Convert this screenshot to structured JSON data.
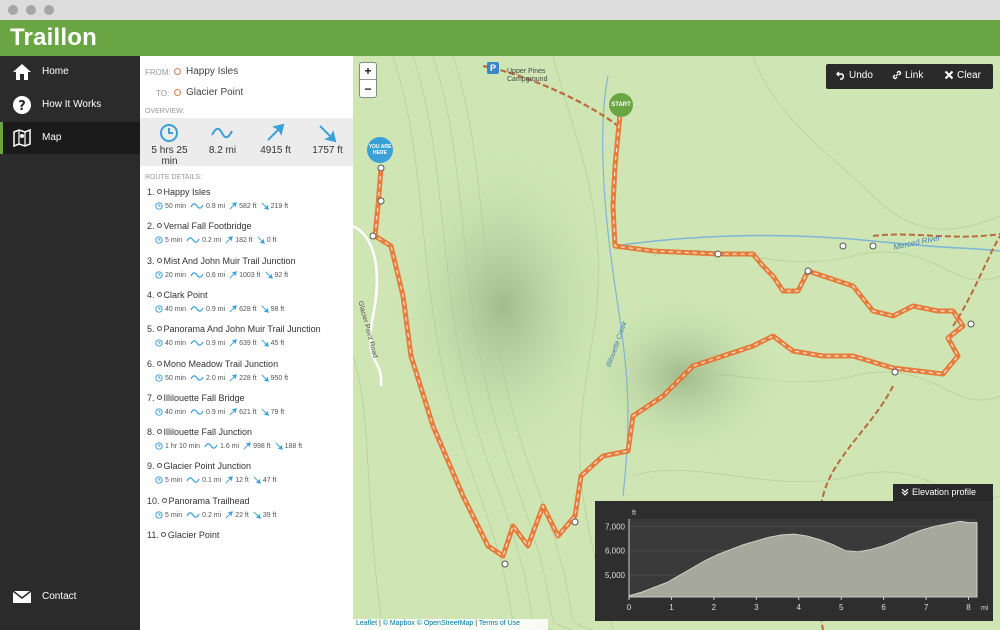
{
  "app": {
    "title": "Traillon"
  },
  "nav": {
    "home": "Home",
    "how": "How It Works",
    "map": "Map",
    "contact": "Contact"
  },
  "route": {
    "from_label": "FROM:",
    "from": "Happy Isles",
    "to_label": "TO:",
    "to": "Glacier Point"
  },
  "overview": {
    "label": "OVERVIEW:",
    "time": "5 hrs 25 min",
    "distance": "8.2 mi",
    "ascent": "4915 ft",
    "descent": "1757 ft"
  },
  "details": {
    "label": "ROUTE DETAILS:",
    "stops": [
      {
        "n": "1.",
        "name": "Happy Isles",
        "time": "50 min",
        "dist": "0.8 mi",
        "up": "582 ft",
        "down": "219 ft"
      },
      {
        "n": "2.",
        "name": "Vernal Fall Footbridge",
        "time": "5 min",
        "dist": "0.2 mi",
        "up": "182 ft",
        "down": "0 ft"
      },
      {
        "n": "3.",
        "name": "Mist And John Muir Trail Junction",
        "time": "20 min",
        "dist": "0.6 mi",
        "up": "1003 ft",
        "down": "92 ft"
      },
      {
        "n": "4.",
        "name": "Clark Point",
        "time": "40 min",
        "dist": "0.9 mi",
        "up": "628 ft",
        "down": "98 ft"
      },
      {
        "n": "5.",
        "name": "Panorama And John Muir Trail Junction",
        "time": "40 min",
        "dist": "0.9 mi",
        "up": "639 ft",
        "down": "45 ft"
      },
      {
        "n": "6.",
        "name": "Mono Meadow Trail Junction",
        "time": "50 min",
        "dist": "2.0 mi",
        "up": "228 ft",
        "down": "950 ft"
      },
      {
        "n": "7.",
        "name": "Illilouette Fall Bridge",
        "time": "40 min",
        "dist": "0.9 mi",
        "up": "621 ft",
        "down": "79 ft"
      },
      {
        "n": "8.",
        "name": "Illilouette Fall Junction",
        "time": "1 hr 10 min",
        "dist": "1.6 mi",
        "up": "998 ft",
        "down": "188 ft"
      },
      {
        "n": "9.",
        "name": "Glacier Point Junction",
        "time": "5 min",
        "dist": "0.1 mi",
        "up": "12 ft",
        "down": "47 ft"
      },
      {
        "n": "10.",
        "name": "Panorama Trailhead",
        "time": "5 min",
        "dist": "0.2 mi",
        "up": "22 ft",
        "down": "39 ft"
      }
    ],
    "last": {
      "n": "11.",
      "name": "Glacier Point"
    }
  },
  "map": {
    "zoom_in": "+",
    "zoom_out": "−",
    "undo": "Undo",
    "link": "Link",
    "clear": "Clear",
    "start": "START",
    "here_line1": "YOU ARE",
    "here_line2": "HERE",
    "parking": "P",
    "labels": {
      "campground": "Upper Pines Campground",
      "river": "Merced River",
      "creek": "Illilouette Creek",
      "road": "Glacier Point Road"
    },
    "attribution": {
      "leaflet": "Leaflet",
      "mapbox": "© Mapbox",
      "osm": "© OpenStreetMap",
      "terms": "Terms of Use"
    }
  },
  "elevation": {
    "tab_label": "Elevation profile",
    "y_unit": "ft",
    "x_unit": "mi",
    "y_ticks": [
      "7,000",
      "6,000",
      "5,000"
    ],
    "x_ticks": [
      "0",
      "1",
      "2",
      "3",
      "4",
      "5",
      "6",
      "7",
      "8"
    ]
  },
  "chart_data": {
    "type": "area",
    "xlabel": "mi",
    "ylabel": "ft",
    "xlim": [
      0,
      8.2
    ],
    "ylim": [
      4100,
      7300
    ],
    "x": [
      0,
      0.3,
      0.6,
      0.9,
      1.2,
      1.5,
      1.8,
      2.1,
      2.4,
      2.7,
      3.0,
      3.3,
      3.6,
      3.9,
      4.2,
      4.5,
      4.8,
      5.1,
      5.4,
      5.7,
      6.0,
      6.3,
      6.6,
      6.9,
      7.2,
      7.5,
      7.8,
      8.0,
      8.2
    ],
    "values": [
      4150,
      4300,
      4500,
      4700,
      5000,
      5300,
      5600,
      5850,
      6050,
      6250,
      6400,
      6550,
      6650,
      6680,
      6600,
      6450,
      6250,
      6000,
      5950,
      6050,
      6200,
      6400,
      6650,
      6850,
      7000,
      7100,
      7200,
      7150,
      7150
    ]
  }
}
